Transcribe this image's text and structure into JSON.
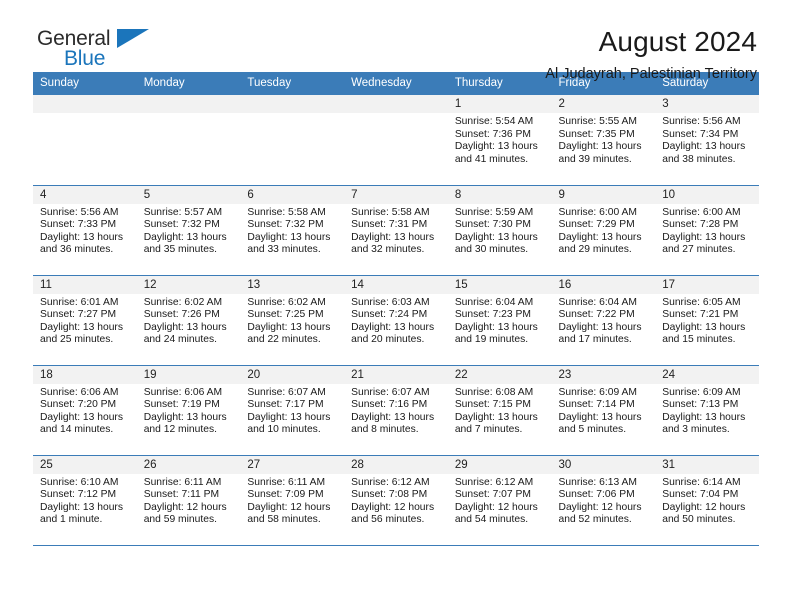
{
  "logo": {
    "word_top": "General",
    "word_bottom": "Blue",
    "triangle": "blue-triangle",
    "accent_color": "#1b75bb"
  },
  "header": {
    "title": "August 2024",
    "subtitle": "Al Judayrah, Palestinian Territory"
  },
  "theme": {
    "header_row_color": "#3b7cb8",
    "daynum_band_color": "#f2f2f2",
    "grid_line_color": "#3b7cb8"
  },
  "calendar": {
    "weekday_headers": [
      "Sunday",
      "Monday",
      "Tuesday",
      "Wednesday",
      "Thursday",
      "Friday",
      "Saturday"
    ],
    "labels": {
      "sunrise": "Sunrise:",
      "sunset": "Sunset:",
      "daylight": "Daylight:"
    },
    "weeks": [
      [
        {
          "day": "",
          "blank": true
        },
        {
          "day": "",
          "blank": true
        },
        {
          "day": "",
          "blank": true
        },
        {
          "day": "",
          "blank": true
        },
        {
          "day": "1",
          "sunrise": "Sunrise: 5:54 AM",
          "sunset": "Sunset: 7:36 PM",
          "daylight_line1": "Daylight: 13 hours",
          "daylight_line2": "and 41 minutes."
        },
        {
          "day": "2",
          "sunrise": "Sunrise: 5:55 AM",
          "sunset": "Sunset: 7:35 PM",
          "daylight_line1": "Daylight: 13 hours",
          "daylight_line2": "and 39 minutes."
        },
        {
          "day": "3",
          "sunrise": "Sunrise: 5:56 AM",
          "sunset": "Sunset: 7:34 PM",
          "daylight_line1": "Daylight: 13 hours",
          "daylight_line2": "and 38 minutes."
        }
      ],
      [
        {
          "day": "4",
          "sunrise": "Sunrise: 5:56 AM",
          "sunset": "Sunset: 7:33 PM",
          "daylight_line1": "Daylight: 13 hours",
          "daylight_line2": "and 36 minutes."
        },
        {
          "day": "5",
          "sunrise": "Sunrise: 5:57 AM",
          "sunset": "Sunset: 7:32 PM",
          "daylight_line1": "Daylight: 13 hours",
          "daylight_line2": "and 35 minutes."
        },
        {
          "day": "6",
          "sunrise": "Sunrise: 5:58 AM",
          "sunset": "Sunset: 7:32 PM",
          "daylight_line1": "Daylight: 13 hours",
          "daylight_line2": "and 33 minutes."
        },
        {
          "day": "7",
          "sunrise": "Sunrise: 5:58 AM",
          "sunset": "Sunset: 7:31 PM",
          "daylight_line1": "Daylight: 13 hours",
          "daylight_line2": "and 32 minutes."
        },
        {
          "day": "8",
          "sunrise": "Sunrise: 5:59 AM",
          "sunset": "Sunset: 7:30 PM",
          "daylight_line1": "Daylight: 13 hours",
          "daylight_line2": "and 30 minutes."
        },
        {
          "day": "9",
          "sunrise": "Sunrise: 6:00 AM",
          "sunset": "Sunset: 7:29 PM",
          "daylight_line1": "Daylight: 13 hours",
          "daylight_line2": "and 29 minutes."
        },
        {
          "day": "10",
          "sunrise": "Sunrise: 6:00 AM",
          "sunset": "Sunset: 7:28 PM",
          "daylight_line1": "Daylight: 13 hours",
          "daylight_line2": "and 27 minutes."
        }
      ],
      [
        {
          "day": "11",
          "sunrise": "Sunrise: 6:01 AM",
          "sunset": "Sunset: 7:27 PM",
          "daylight_line1": "Daylight: 13 hours",
          "daylight_line2": "and 25 minutes."
        },
        {
          "day": "12",
          "sunrise": "Sunrise: 6:02 AM",
          "sunset": "Sunset: 7:26 PM",
          "daylight_line1": "Daylight: 13 hours",
          "daylight_line2": "and 24 minutes."
        },
        {
          "day": "13",
          "sunrise": "Sunrise: 6:02 AM",
          "sunset": "Sunset: 7:25 PM",
          "daylight_line1": "Daylight: 13 hours",
          "daylight_line2": "and 22 minutes."
        },
        {
          "day": "14",
          "sunrise": "Sunrise: 6:03 AM",
          "sunset": "Sunset: 7:24 PM",
          "daylight_line1": "Daylight: 13 hours",
          "daylight_line2": "and 20 minutes."
        },
        {
          "day": "15",
          "sunrise": "Sunrise: 6:04 AM",
          "sunset": "Sunset: 7:23 PM",
          "daylight_line1": "Daylight: 13 hours",
          "daylight_line2": "and 19 minutes."
        },
        {
          "day": "16",
          "sunrise": "Sunrise: 6:04 AM",
          "sunset": "Sunset: 7:22 PM",
          "daylight_line1": "Daylight: 13 hours",
          "daylight_line2": "and 17 minutes."
        },
        {
          "day": "17",
          "sunrise": "Sunrise: 6:05 AM",
          "sunset": "Sunset: 7:21 PM",
          "daylight_line1": "Daylight: 13 hours",
          "daylight_line2": "and 15 minutes."
        }
      ],
      [
        {
          "day": "18",
          "sunrise": "Sunrise: 6:06 AM",
          "sunset": "Sunset: 7:20 PM",
          "daylight_line1": "Daylight: 13 hours",
          "daylight_line2": "and 14 minutes."
        },
        {
          "day": "19",
          "sunrise": "Sunrise: 6:06 AM",
          "sunset": "Sunset: 7:19 PM",
          "daylight_line1": "Daylight: 13 hours",
          "daylight_line2": "and 12 minutes."
        },
        {
          "day": "20",
          "sunrise": "Sunrise: 6:07 AM",
          "sunset": "Sunset: 7:17 PM",
          "daylight_line1": "Daylight: 13 hours",
          "daylight_line2": "and 10 minutes."
        },
        {
          "day": "21",
          "sunrise": "Sunrise: 6:07 AM",
          "sunset": "Sunset: 7:16 PM",
          "daylight_line1": "Daylight: 13 hours",
          "daylight_line2": "and 8 minutes."
        },
        {
          "day": "22",
          "sunrise": "Sunrise: 6:08 AM",
          "sunset": "Sunset: 7:15 PM",
          "daylight_line1": "Daylight: 13 hours",
          "daylight_line2": "and 7 minutes."
        },
        {
          "day": "23",
          "sunrise": "Sunrise: 6:09 AM",
          "sunset": "Sunset: 7:14 PM",
          "daylight_line1": "Daylight: 13 hours",
          "daylight_line2": "and 5 minutes."
        },
        {
          "day": "24",
          "sunrise": "Sunrise: 6:09 AM",
          "sunset": "Sunset: 7:13 PM",
          "daylight_line1": "Daylight: 13 hours",
          "daylight_line2": "and 3 minutes."
        }
      ],
      [
        {
          "day": "25",
          "sunrise": "Sunrise: 6:10 AM",
          "sunset": "Sunset: 7:12 PM",
          "daylight_line1": "Daylight: 13 hours",
          "daylight_line2": "and 1 minute."
        },
        {
          "day": "26",
          "sunrise": "Sunrise: 6:11 AM",
          "sunset": "Sunset: 7:11 PM",
          "daylight_line1": "Daylight: 12 hours",
          "daylight_line2": "and 59 minutes."
        },
        {
          "day": "27",
          "sunrise": "Sunrise: 6:11 AM",
          "sunset": "Sunset: 7:09 PM",
          "daylight_line1": "Daylight: 12 hours",
          "daylight_line2": "and 58 minutes."
        },
        {
          "day": "28",
          "sunrise": "Sunrise: 6:12 AM",
          "sunset": "Sunset: 7:08 PM",
          "daylight_line1": "Daylight: 12 hours",
          "daylight_line2": "and 56 minutes."
        },
        {
          "day": "29",
          "sunrise": "Sunrise: 6:12 AM",
          "sunset": "Sunset: 7:07 PM",
          "daylight_line1": "Daylight: 12 hours",
          "daylight_line2": "and 54 minutes."
        },
        {
          "day": "30",
          "sunrise": "Sunrise: 6:13 AM",
          "sunset": "Sunset: 7:06 PM",
          "daylight_line1": "Daylight: 12 hours",
          "daylight_line2": "and 52 minutes."
        },
        {
          "day": "31",
          "sunrise": "Sunrise: 6:14 AM",
          "sunset": "Sunset: 7:04 PM",
          "daylight_line1": "Daylight: 12 hours",
          "daylight_line2": "and 50 minutes."
        }
      ]
    ]
  }
}
